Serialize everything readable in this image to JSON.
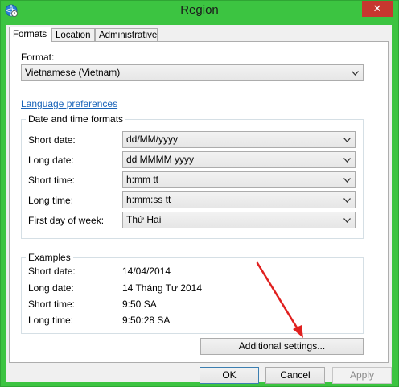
{
  "window": {
    "title": "Region",
    "close_glyph": "✕"
  },
  "tabs": [
    {
      "label": "Formats",
      "active": true
    },
    {
      "label": "Location",
      "active": false
    },
    {
      "label": "Administrative",
      "active": false
    }
  ],
  "format": {
    "label": "Format:",
    "value": "Vietnamese (Vietnam)"
  },
  "language_link": "Language preferences",
  "date_time": {
    "title": "Date and time formats",
    "rows": [
      {
        "label": "Short date:",
        "value": "dd/MM/yyyy"
      },
      {
        "label": "Long date:",
        "value": "dd MMMM yyyy"
      },
      {
        "label": "Short time:",
        "value": "h:mm tt"
      },
      {
        "label": "Long time:",
        "value": "h:mm:ss tt"
      },
      {
        "label": "First day of week:",
        "value": "Thứ Hai"
      }
    ]
  },
  "examples": {
    "title": "Examples",
    "rows": [
      {
        "label": "Short date:",
        "value": "14/04/2014"
      },
      {
        "label": "Long date:",
        "value": "14 Tháng Tư 2014"
      },
      {
        "label": "Short time:",
        "value": "9:50 SA"
      },
      {
        "label": "Long time:",
        "value": "9:50:28 SA"
      }
    ]
  },
  "buttons": {
    "additional": "Additional settings...",
    "ok": "OK",
    "cancel": "Cancel",
    "apply": "Apply"
  },
  "colors": {
    "window_frame": "#3cc441",
    "link": "#1a64b9",
    "annotation_arrow": "#e0201f"
  },
  "icons": {
    "app": "globe-clock-icon",
    "dropdown": "chevron-down-icon"
  }
}
